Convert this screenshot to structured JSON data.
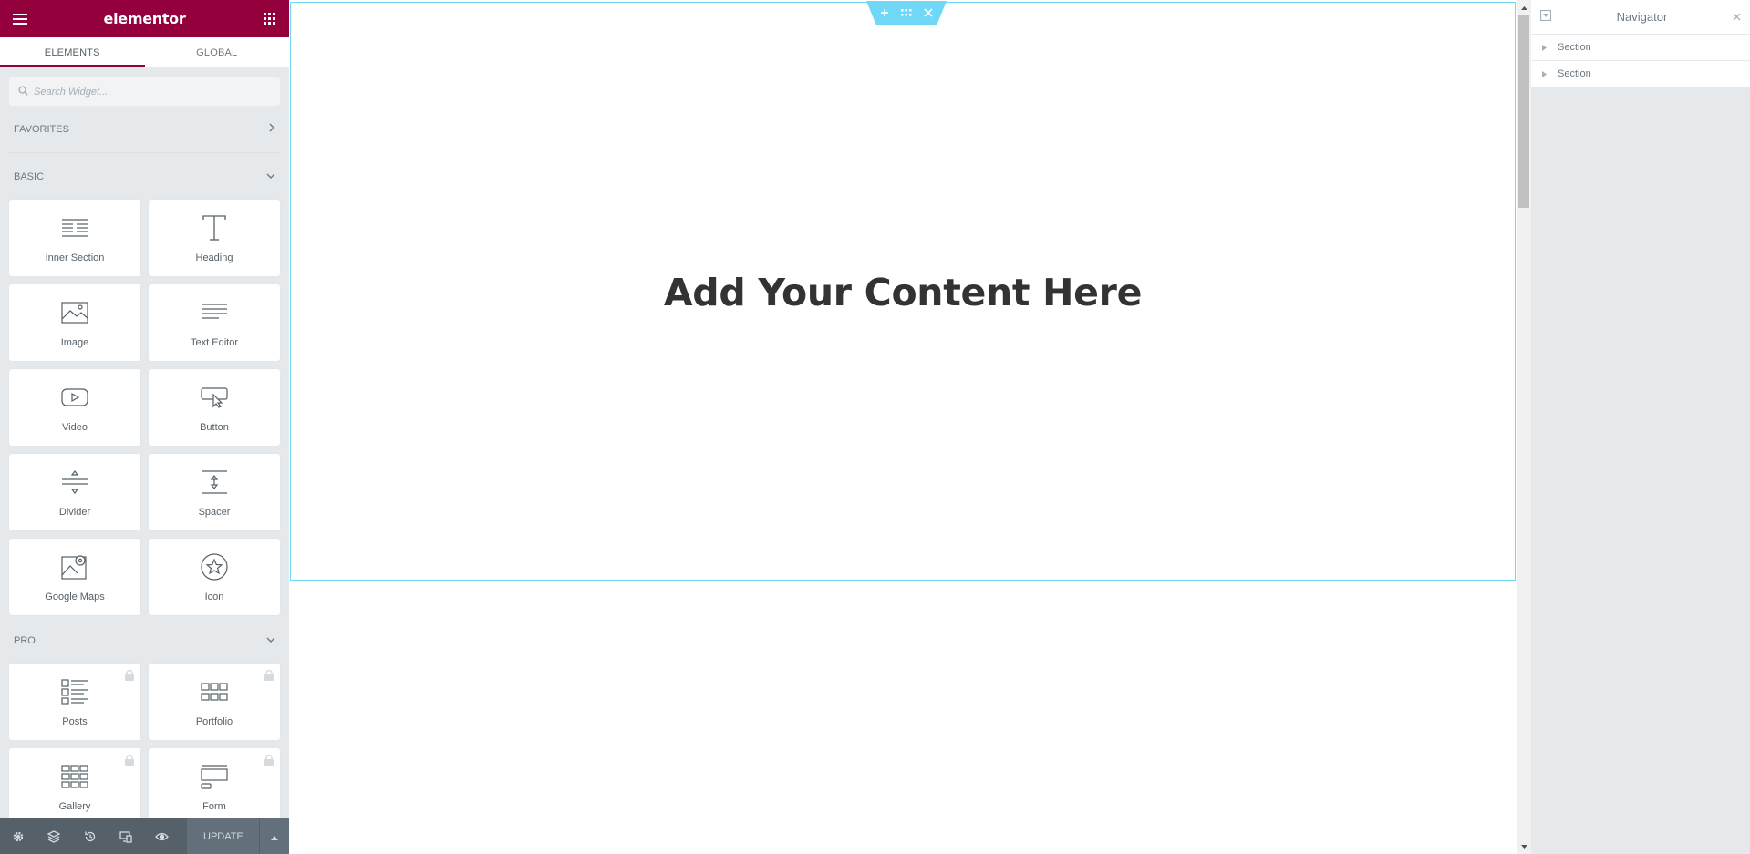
{
  "panel": {
    "title": "elementor",
    "tabs": [
      {
        "label": "ELEMENTS",
        "active": true
      },
      {
        "label": "GLOBAL",
        "active": false
      }
    ],
    "search_placeholder": "Search Widget...",
    "categories": {
      "favorites": {
        "label": "FAVORITES"
      },
      "basic": {
        "label": "BASIC",
        "widgets": [
          {
            "label": "Inner Section",
            "icon": "inner-section-icon"
          },
          {
            "label": "Heading",
            "icon": "heading-icon"
          },
          {
            "label": "Image",
            "icon": "image-icon"
          },
          {
            "label": "Text Editor",
            "icon": "text-editor-icon"
          },
          {
            "label": "Video",
            "icon": "video-icon"
          },
          {
            "label": "Button",
            "icon": "button-icon"
          },
          {
            "label": "Divider",
            "icon": "divider-icon"
          },
          {
            "label": "Spacer",
            "icon": "spacer-icon"
          },
          {
            "label": "Google Maps",
            "icon": "google-maps-icon"
          },
          {
            "label": "Icon",
            "icon": "star-icon"
          }
        ]
      },
      "pro": {
        "label": "PRO",
        "widgets": [
          {
            "label": "Posts",
            "icon": "posts-icon",
            "locked": true
          },
          {
            "label": "Portfolio",
            "icon": "portfolio-icon",
            "locked": true
          },
          {
            "label": "Gallery",
            "icon": "gallery-icon",
            "locked": true
          },
          {
            "label": "Form",
            "icon": "form-icon",
            "locked": true
          }
        ]
      }
    },
    "footer": {
      "update_label": "UPDATE"
    }
  },
  "canvas": {
    "heading": "Add Your Content Here"
  },
  "navigator": {
    "title": "Navigator",
    "items": [
      {
        "label": "Section"
      },
      {
        "label": "Section"
      }
    ]
  },
  "colors": {
    "brand": "#93003c",
    "section_outline": "#71d7f7",
    "panel_bg": "#e6e9ec",
    "footer_bg": "#556068"
  }
}
